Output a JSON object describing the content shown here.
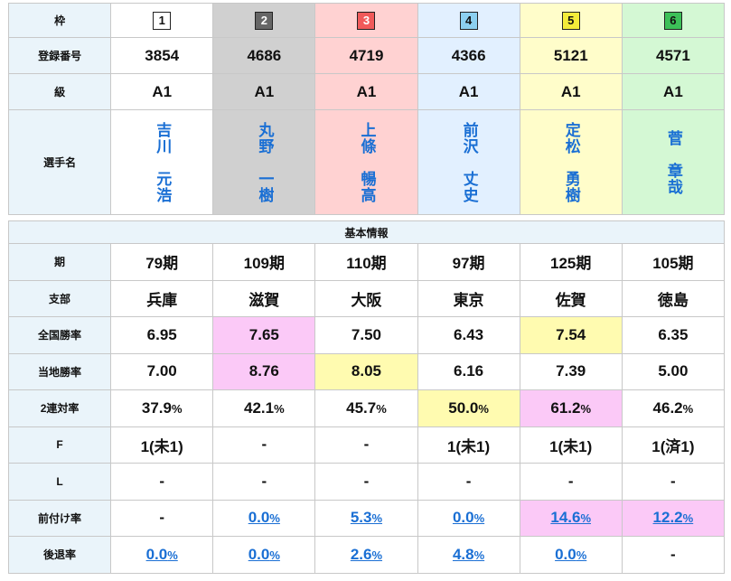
{
  "header": {
    "waku_label": "枠",
    "reg_label": "登録番号",
    "kyu_label": "級",
    "name_label": "選手名"
  },
  "boats": [
    {
      "waku": "1",
      "reg": "3854",
      "kyu": "A1",
      "name_a": "吉川",
      "name_b": "元浩"
    },
    {
      "waku": "2",
      "reg": "4686",
      "kyu": "A1",
      "name_a": "丸野",
      "name_b": "一樹"
    },
    {
      "waku": "3",
      "reg": "4719",
      "kyu": "A1",
      "name_a": "上條",
      "name_b": "暢高"
    },
    {
      "waku": "4",
      "reg": "4366",
      "kyu": "A1",
      "name_a": "前沢",
      "name_b": "丈史"
    },
    {
      "waku": "5",
      "reg": "5121",
      "kyu": "A1",
      "name_a": "定松",
      "name_b": "勇樹"
    },
    {
      "waku": "6",
      "reg": "4571",
      "kyu": "A1",
      "name_a": "菅",
      "name_b": "章哉"
    }
  ],
  "basic": {
    "title": "基本情報",
    "labels": {
      "ki": "期",
      "shibu": "支部",
      "zenkoku": "全国勝率",
      "touchi": "当地勝率",
      "rentai": "2連対率",
      "f": "F",
      "l": "L",
      "maezuke": "前付け率",
      "koutai": "後退率"
    },
    "ki": [
      "79期",
      "109期",
      "110期",
      "97期",
      "125期",
      "105期"
    ],
    "shibu": [
      "兵庫",
      "滋賀",
      "大阪",
      "東京",
      "佐賀",
      "徳島"
    ],
    "zenkoku": [
      "6.95",
      "7.65",
      "7.50",
      "6.43",
      "7.54",
      "6.35"
    ],
    "touchi": [
      "7.00",
      "8.76",
      "8.05",
      "6.16",
      "7.39",
      "5.00"
    ],
    "rentai": [
      "37.9",
      "42.1",
      "45.7",
      "50.0",
      "61.2",
      "46.2"
    ],
    "pct_unit": "%",
    "f": [
      "1(未1)",
      "-",
      "-",
      "1(未1)",
      "1(未1)",
      "1(済1)"
    ],
    "l": [
      "-",
      "-",
      "-",
      "-",
      "-",
      "-"
    ],
    "maezuke": [
      "-",
      "0.0",
      "5.3",
      "0.0",
      "14.6",
      "12.2"
    ],
    "koutai": [
      "0.0",
      "0.0",
      "2.6",
      "4.8",
      "0.0",
      "-"
    ]
  },
  "colors": {
    "highlight_pink": "#fbc9f7",
    "highlight_yellow": "#fffbb0",
    "link_blue": "#1a6fd4"
  }
}
